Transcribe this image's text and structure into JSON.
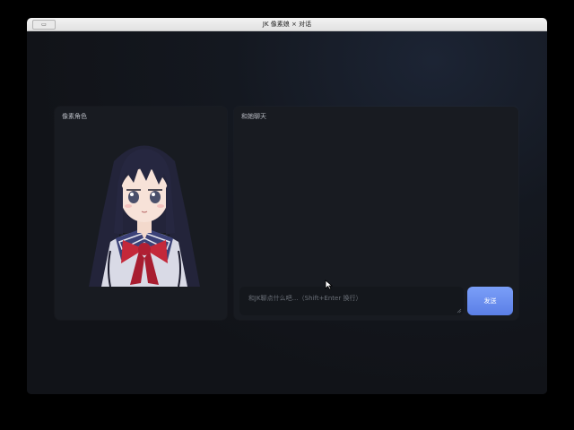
{
  "window": {
    "title": "JK 像素娘 × 对话",
    "toolbar_button": "▭"
  },
  "left_panel": {
    "title": "像素角色",
    "image": "pixel-anime-schoolgirl"
  },
  "right_panel": {
    "title": "和她聊天",
    "input": {
      "placeholder": "和JK聊点什么吧…（Shift+Enter 换行）",
      "value": ""
    },
    "send_label": "发送"
  },
  "colors": {
    "accent": "#6b8ff0",
    "panel": "#181b21",
    "background": "#121419"
  }
}
